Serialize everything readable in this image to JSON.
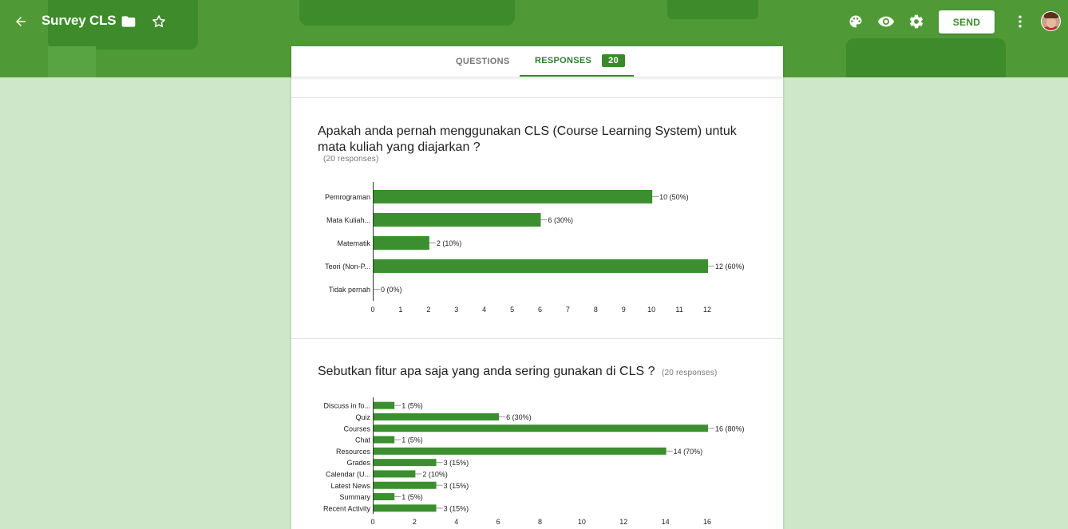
{
  "header": {
    "title": "Survey CLS",
    "send_label": "SEND",
    "accent": "#4f9a37"
  },
  "tabs": {
    "questions_label": "QUESTIONS",
    "responses_label": "RESPONSES",
    "responses_count": "20"
  },
  "questions": [
    {
      "title": "Apakah anda pernah menggunakan CLS (Course Learning System) untuk mata kuliah yang diajarkan ?",
      "responses": "(20 responses)"
    },
    {
      "title": "Sebutkan fitur apa saja yang anda sering gunakan di CLS ?",
      "responses": "(20 responses)"
    }
  ],
  "chart_data": [
    {
      "type": "bar",
      "orientation": "horizontal",
      "categories": [
        "Pemrograman",
        "Mata Kuliah...",
        "Matematik",
        "Teori (Non-P...",
        "Tidak pernah"
      ],
      "values": [
        10,
        6,
        2,
        12,
        0
      ],
      "data_labels": [
        "10 (50%)",
        "6 (30%)",
        "2 (10%)",
        "12 (60%)",
        "0 (0%)"
      ],
      "xticks": [
        0,
        1,
        2,
        3,
        4,
        5,
        6,
        7,
        8,
        9,
        10,
        11,
        12
      ],
      "xlim": [
        0,
        12
      ],
      "color": "#3b8f2e"
    },
    {
      "type": "bar",
      "orientation": "horizontal",
      "categories": [
        "Discuss in fo...",
        "Quiz",
        "Courses",
        "Chat",
        "Resources",
        "Grades",
        "Calendar (U...",
        "Latest News",
        "Summary",
        "Recent Activity"
      ],
      "values": [
        1,
        6,
        16,
        1,
        14,
        3,
        2,
        3,
        1,
        3
      ],
      "data_labels": [
        "1 (5%)",
        "6 (30%)",
        "16 (80%)",
        "1 (5%)",
        "14 (70%)",
        "3 (15%)",
        "2 (10%)",
        "3 (15%)",
        "1 (5%)",
        "3 (15%)"
      ],
      "xticks": [
        0,
        2,
        4,
        6,
        8,
        10,
        12,
        14,
        16
      ],
      "xlim": [
        0,
        16
      ],
      "color": "#3b8f2e"
    }
  ]
}
